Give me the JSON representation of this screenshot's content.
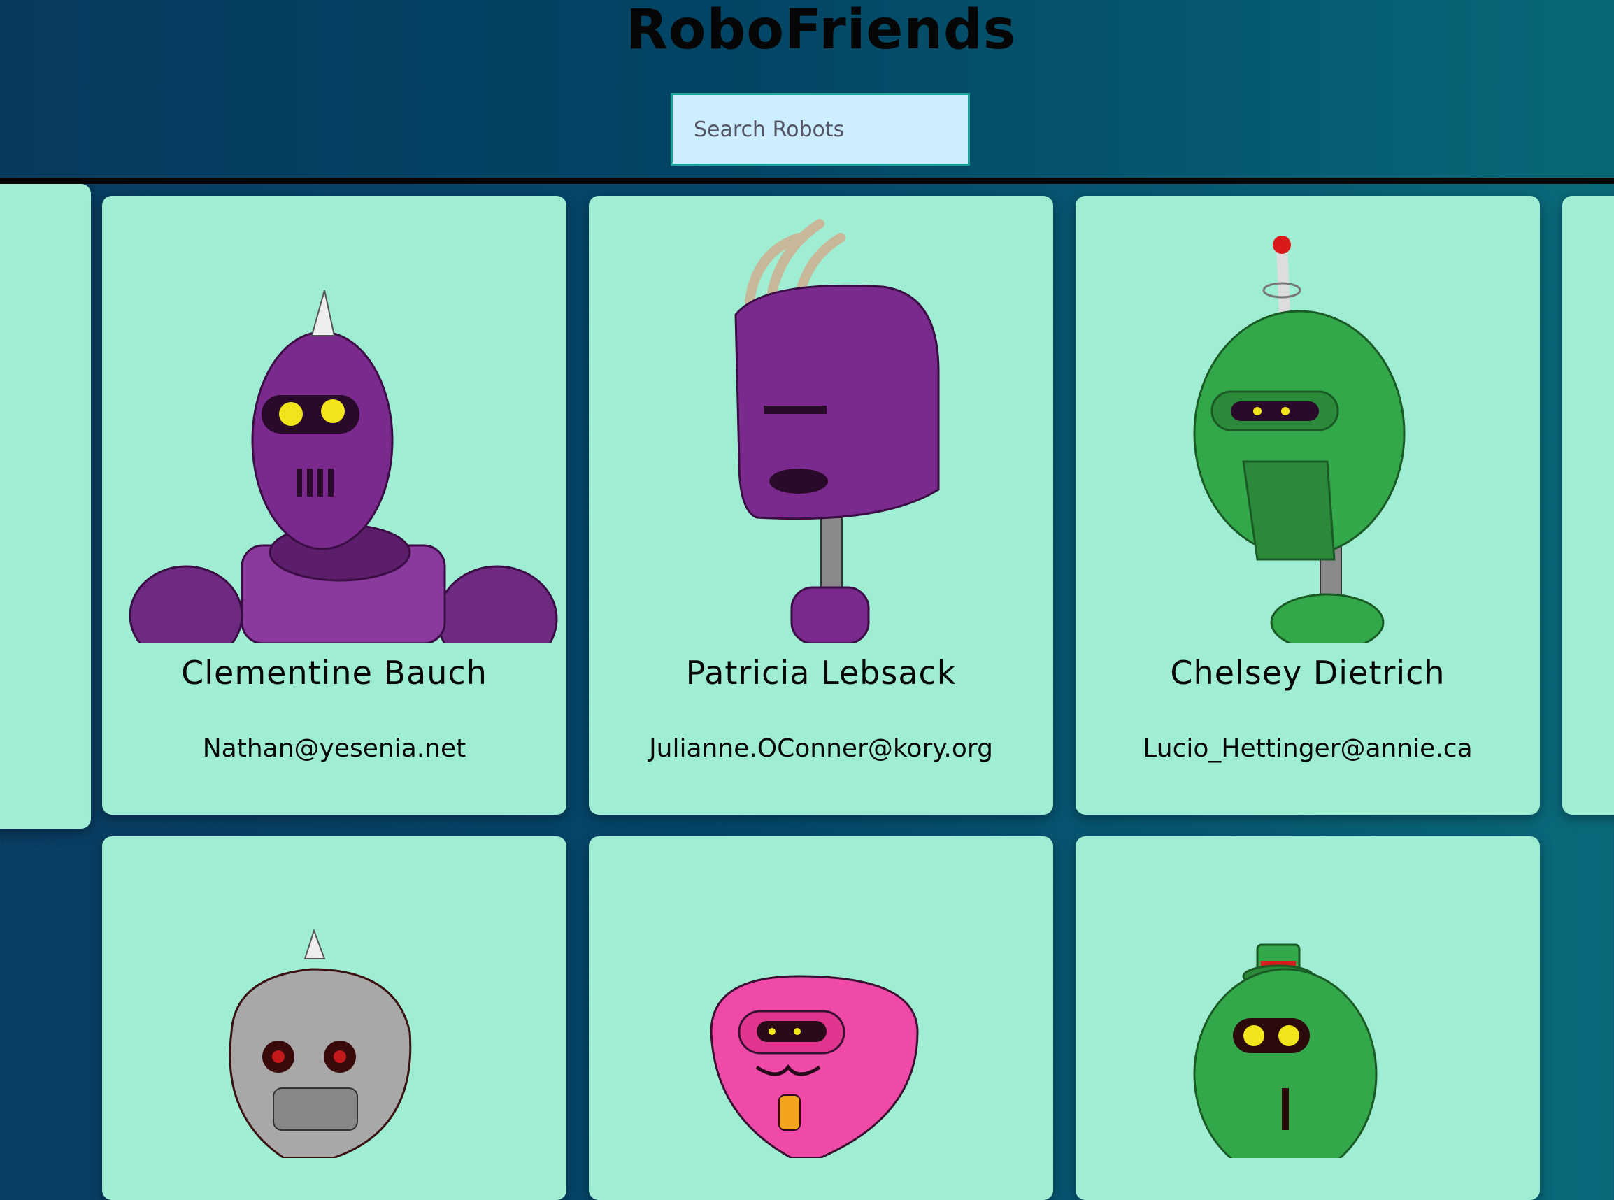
{
  "app": {
    "title": "RoboFriends"
  },
  "search": {
    "placeholder": "Search Robots",
    "value": ""
  },
  "robots": [
    {
      "name": "Clementine Bauch",
      "email": "Nathan@yesenia.net",
      "color": "#7a2a8c"
    },
    {
      "name": "Patricia Lebsack",
      "email": "Julianne.OConner@kory.org",
      "color": "#7a2a8c"
    },
    {
      "name": "Chelsey Dietrich",
      "email": "Lucio_Hettinger@annie.ca",
      "color": "#33a84a"
    },
    {
      "name": "",
      "email": "",
      "color": "#a8a8a8"
    },
    {
      "name": "",
      "email": "",
      "color": "#f04aa8"
    },
    {
      "name": "",
      "email": "",
      "color": "#33a84a"
    }
  ],
  "colors": {
    "card_bg": "#9feed3",
    "search_bg": "#cdeeff",
    "search_border": "#19a49a"
  }
}
